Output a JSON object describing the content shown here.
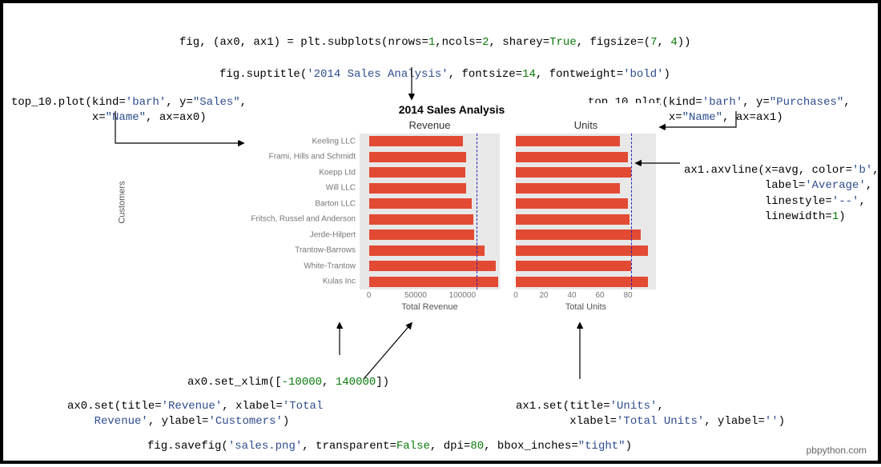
{
  "code": {
    "line_subplots_pre": "fig, (ax0, ax1) = plt.subplots(nrows=",
    "line_subplots_n1": "1",
    "line_subplots_mid1": ",ncols=",
    "line_subplots_n2": "2",
    "line_subplots_mid2": ", sharey=",
    "line_subplots_true": "True",
    "line_subplots_mid3": ", figsize=(",
    "line_subplots_n3": "7",
    "line_subplots_mid4": ", ",
    "line_subplots_n4": "4",
    "line_subplots_end": "))",
    "line_suptitle_pre": "fig.suptitle(",
    "line_suptitle_str": "'2014 Sales Analysis'",
    "line_suptitle_mid": ", fontsize=",
    "line_suptitle_n": "14",
    "line_suptitle_mid2": ", fontweight=",
    "line_suptitle_str2": "'bold'",
    "line_suptitle_end": ")",
    "line_top10_left_a": "top_10.plot(kind=",
    "line_top10_left_s1": "'barh'",
    "line_top10_left_b": ", y=",
    "line_top10_left_s2": "\"Sales\"",
    "line_top10_left_c": ",",
    "line_top10_left_d": "            x=",
    "line_top10_left_s3": "\"Name\"",
    "line_top10_left_e": ", ax=ax0)",
    "line_top10_right_a": "top_10.plot(kind=",
    "line_top10_right_s1": "'barh'",
    "line_top10_right_b": ", y=",
    "line_top10_right_s2": "\"Purchases\"",
    "line_top10_right_c": ",",
    "line_top10_right_d": "            x=",
    "line_top10_right_s3": "\"Name\"",
    "line_top10_right_e": ", ax=ax1)",
    "line_avline_a": "ax1.axvline(x=avg, color=",
    "line_avline_s1": "'b'",
    "line_avline_b": ",",
    "line_avline_c": "            label=",
    "line_avline_s2": "'Average'",
    "line_avline_d": ",",
    "line_avline_e": "            linestyle=",
    "line_avline_s3": "'--'",
    "line_avline_f": ",",
    "line_avline_g": "            linewidth=",
    "line_avline_n": "1",
    "line_avline_h": ")",
    "line_xlim_a": "ax0.set_xlim([",
    "line_xlim_n1": "-10000",
    "line_xlim_b": ", ",
    "line_xlim_n2": "140000",
    "line_xlim_c": "])",
    "line_ax0set_a": "ax0.set(title=",
    "line_ax0set_s1": "'Revenue'",
    "line_ax0set_b": ", xlabel=",
    "line_ax0set_s2": "'Total\n    Revenue'",
    "line_ax0set_c": ", ylabel=",
    "line_ax0set_s3": "'Customers'",
    "line_ax0set_d": ")",
    "line_ax1set_a": "ax1.set(title=",
    "line_ax1set_s1": "'Units'",
    "line_ax1set_b": ",",
    "line_ax1set_c": "        xlabel=",
    "line_ax1set_s2": "'Total Units'",
    "line_ax1set_d": ", ylabel=",
    "line_ax1set_s3": "''",
    "line_ax1set_e": ")",
    "line_savefig_a": "fig.savefig(",
    "line_savefig_s1": "'sales.png'",
    "line_savefig_b": ", transparent=",
    "line_savefig_kw": "False",
    "line_savefig_c": ", dpi=",
    "line_savefig_n": "80",
    "line_savefig_d": ", bbox_inches=",
    "line_savefig_s2": "\"tight\"",
    "line_savefig_e": ")"
  },
  "footer": "pbpython.com",
  "chart_data": [
    {
      "type": "bar",
      "orientation": "horizontal",
      "title": "Revenue",
      "xlabel": "Total Revenue",
      "ylabel": "Customers",
      "xlim": [
        -10000,
        140000
      ],
      "xticks": [
        0,
        50000,
        100000
      ],
      "categories": [
        "Keeling LLC",
        "Frami, Hills and Schmidt",
        "Koepp Ltd",
        "Will LLC",
        "Barton LLC",
        "Fritsch, Russel and Anderson",
        "Jerde-Hilpert",
        "Trantow-Barrows",
        "White-Trantow",
        "Kulas Inc"
      ],
      "values": [
        101000,
        104000,
        103000,
        104000,
        110000,
        112000,
        113000,
        124000,
        136000,
        138000
      ],
      "avg_line": 115000,
      "suptitle": "2014 Sales Analysis"
    },
    {
      "type": "bar",
      "orientation": "horizontal",
      "title": "Units",
      "xlabel": "Total Units",
      "ylabel": "",
      "xlim": [
        0,
        100
      ],
      "xticks": [
        0,
        20,
        40,
        60,
        80
      ],
      "categories": [
        "Keeling LLC",
        "Frami, Hills and Schmidt",
        "Koepp Ltd",
        "Will LLC",
        "Barton LLC",
        "Fritsch, Russel and Anderson",
        "Jerde-Hilpert",
        "Trantow-Barrows",
        "White-Trantow",
        "Kulas Inc"
      ],
      "values": [
        74,
        80,
        82,
        74,
        80,
        81,
        89,
        94,
        82,
        94
      ],
      "avg_line": 82
    }
  ]
}
